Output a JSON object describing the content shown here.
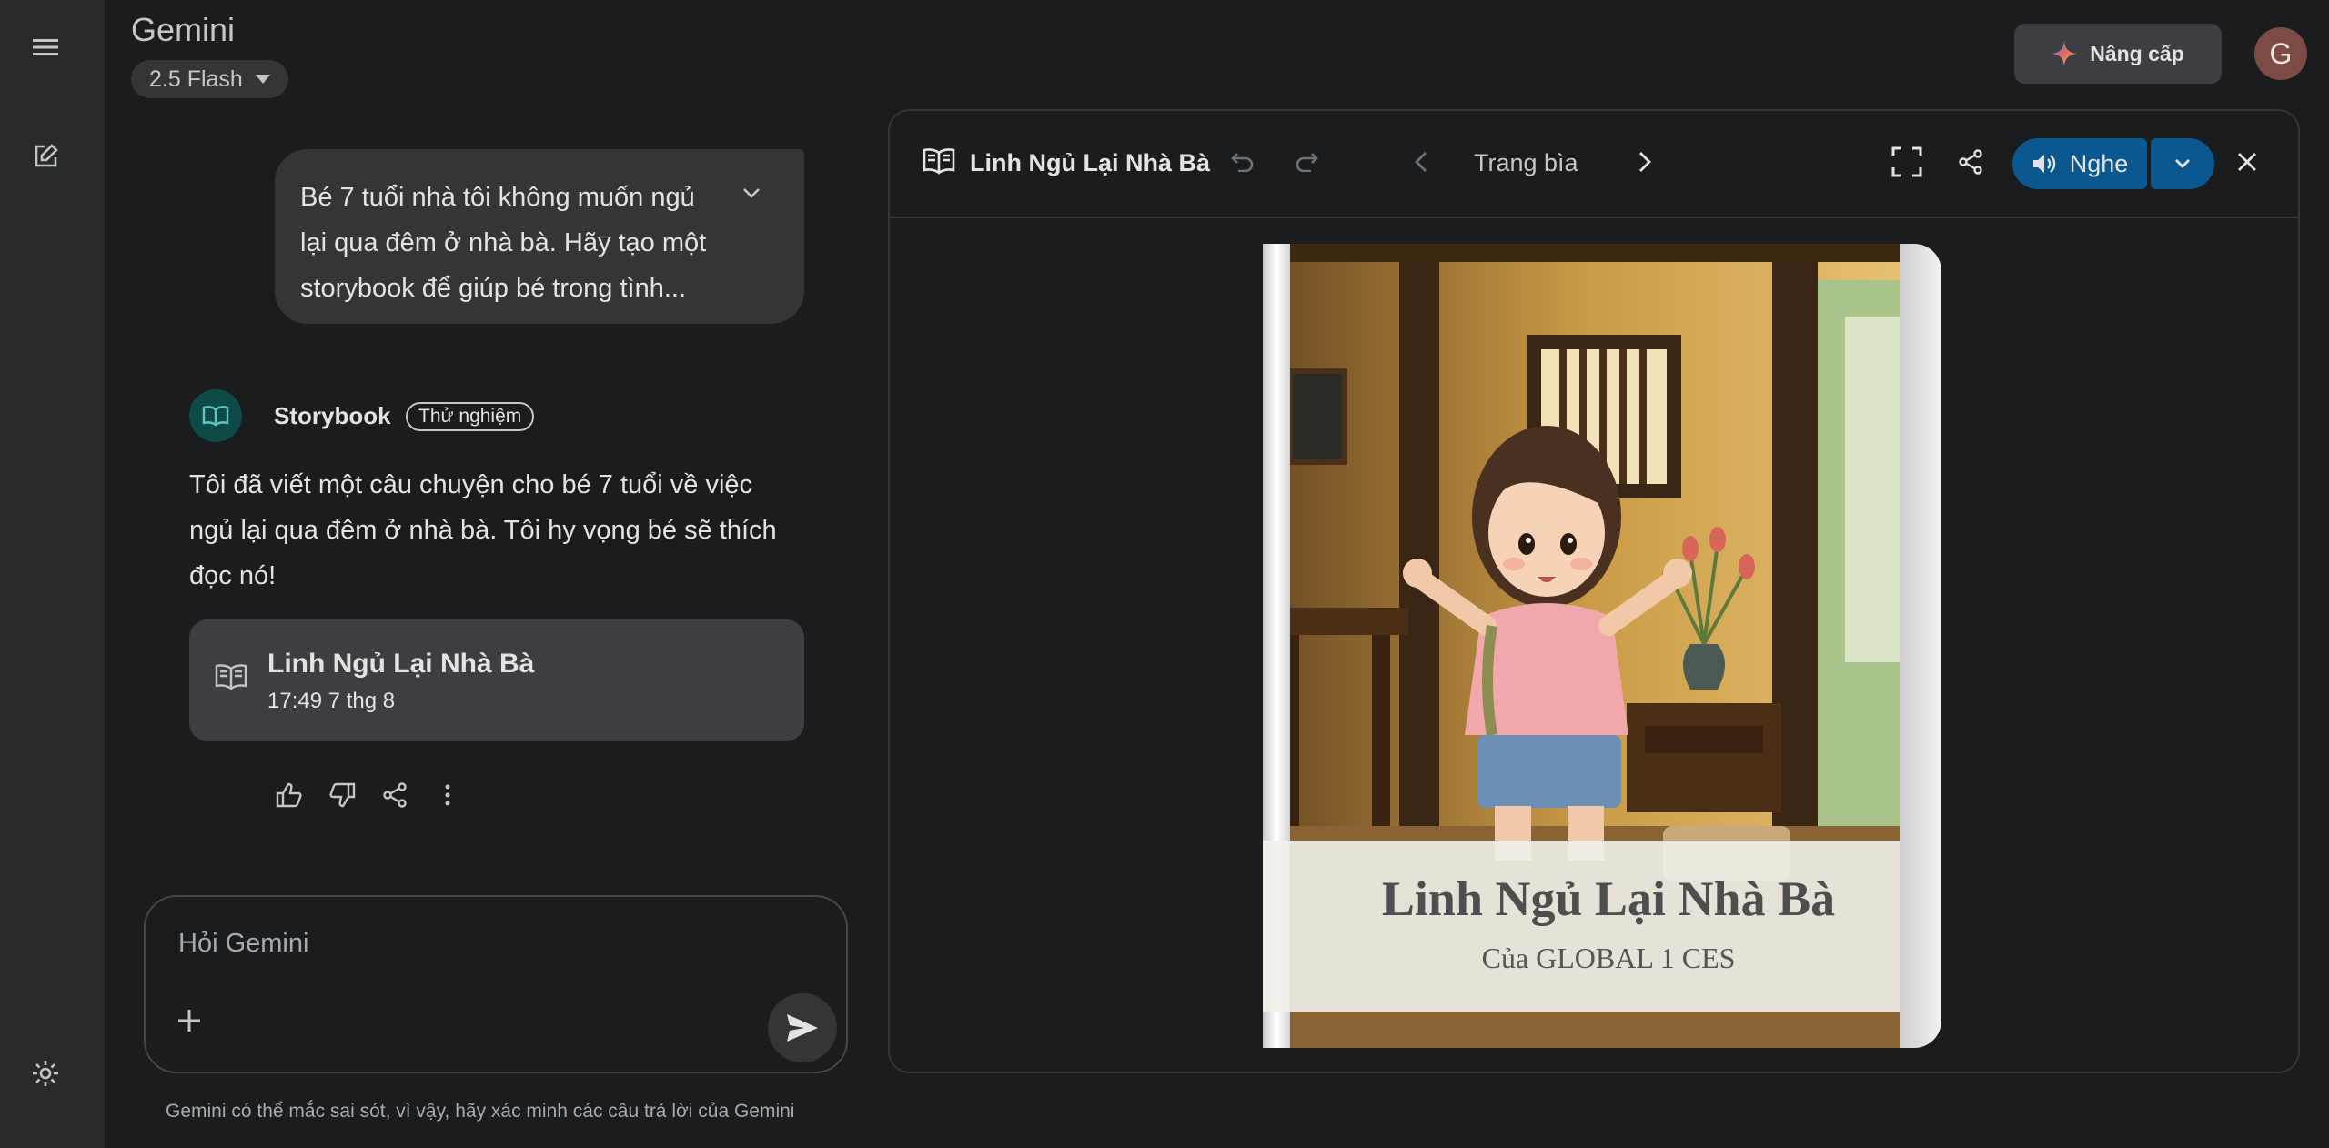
{
  "app": {
    "title": "Gemini",
    "model": "2.5 Flash"
  },
  "header": {
    "upgrade_label": "Nâng cấp",
    "avatar_letter": "G"
  },
  "sidebar": {
    "icons": [
      "menu-icon",
      "new-chat-icon",
      "settings-icon"
    ]
  },
  "conversation": {
    "user_message": "Bé 7 tuổi nhà tôi không muốn ngủ lại qua đêm ở nhà bà. Hãy tạo một storybook để giúp bé trong tình...",
    "assistant": {
      "name": "Storybook",
      "badge": "Thử nghiệm",
      "reply": "Tôi đã viết một câu chuyện cho bé 7 tuổi về việc ngủ lại qua đêm ở nhà bà. Tôi hy vọng bé sẽ thích đọc nó!",
      "card_title": "Linh Ngủ Lại Nhà Bà",
      "card_date": "17:49 7 thg 8"
    }
  },
  "input": {
    "placeholder": "Hỏi Gemini"
  },
  "disclaimer": "Gemini có thể mắc sai sót, vì vậy, hãy xác minh các câu trả lời của Gemini",
  "panel": {
    "title": "Linh Ngủ Lại Nhà Bà",
    "page_label": "Trang bìa",
    "listen_label": "Nghe",
    "cover_title": "Linh Ngủ Lại Nhà Bà",
    "cover_author": "Của GLOBAL 1 CES"
  },
  "colors": {
    "background": "#1b1c1d",
    "rail": "#282a2c",
    "accent": "#0b578f",
    "bubble": "#333537"
  }
}
